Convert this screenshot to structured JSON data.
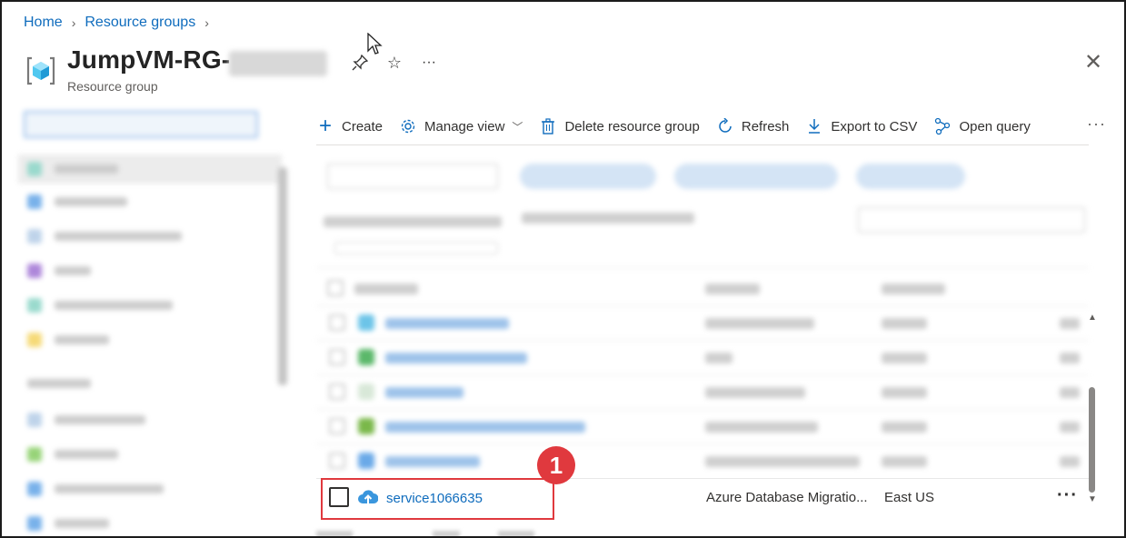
{
  "breadcrumb": {
    "home": "Home",
    "resource_groups": "Resource groups"
  },
  "header": {
    "title": "JumpVM-RG-",
    "subtitle": "Resource group"
  },
  "toolbar": {
    "create": "Create",
    "manage_view": "Manage view",
    "delete_resource_group": "Delete resource group",
    "refresh": "Refresh",
    "export_csv": "Export to CSV",
    "open_query": "Open query",
    "more": "···"
  },
  "resource_row": {
    "name": "service1066635",
    "type": "Azure Database Migratio...",
    "location": "East US",
    "more": "···"
  },
  "callout": {
    "number": "1"
  },
  "colors": {
    "link": "#0f6cbd",
    "highlight": "#e0393e"
  }
}
